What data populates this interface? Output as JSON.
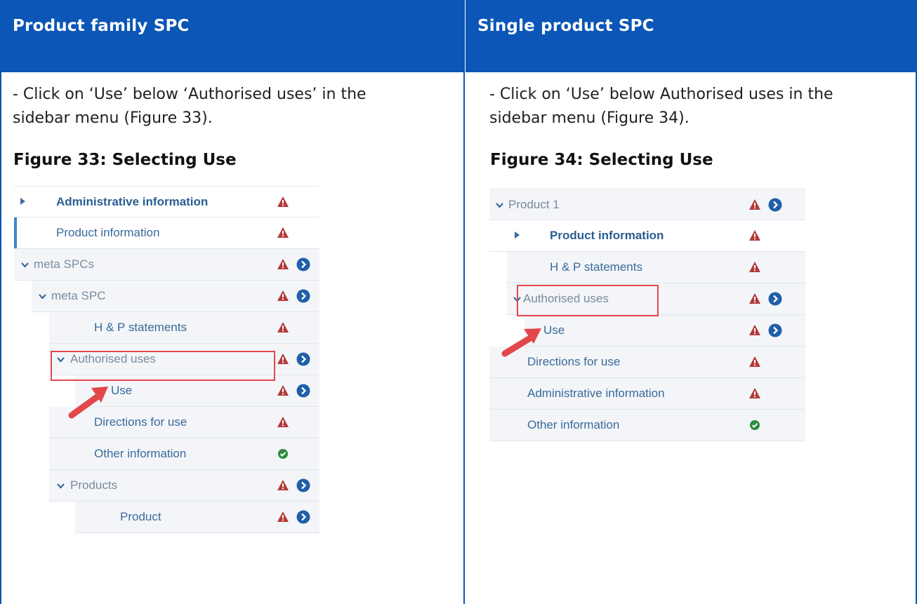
{
  "headers": {
    "left": "Product family SPC",
    "right": "Single product SPC"
  },
  "left": {
    "instruction_line1": "- Click on ‘Use’ below ‘Authorised uses’ in the",
    "instruction_line2": "sidebar menu (Figure 33).",
    "figure_title": "Figure 33: Selecting Use",
    "menu": [
      {
        "label": "Administrative information",
        "expander": "caret",
        "status": [
          "warning-icon"
        ]
      },
      {
        "label": "Product information",
        "status": [
          "warning-icon"
        ]
      },
      {
        "label": "meta SPCs",
        "expander": "chevron",
        "status": [
          "warning-icon",
          "go-icon"
        ]
      },
      {
        "label": "meta SPC",
        "expander": "chevron",
        "status": [
          "warning-icon",
          "go-icon"
        ]
      },
      {
        "label": "H & P statements",
        "status": [
          "warning-icon"
        ]
      },
      {
        "label": "Authorised uses",
        "expander": "chevron",
        "status": [
          "warning-icon",
          "go-icon"
        ]
      },
      {
        "label": "Use",
        "status": [
          "warning-icon",
          "go-icon"
        ]
      },
      {
        "label": "Directions for use",
        "status": [
          "warning-icon"
        ]
      },
      {
        "label": "Other information",
        "status": [
          "check-icon"
        ]
      },
      {
        "label": "Products",
        "expander": "chevron",
        "status": [
          "warning-icon",
          "go-icon"
        ]
      },
      {
        "label": "Product",
        "status": [
          "warning-icon",
          "go-icon"
        ]
      }
    ]
  },
  "right": {
    "instruction_line1": "- Click on ‘Use’ below Authorised uses in the",
    "instruction_line2": "sidebar menu (Figure 34).",
    "figure_title": "Figure 34: Selecting Use",
    "menu": [
      {
        "label": "Product 1",
        "expander": "chevron",
        "status": [
          "warning-icon",
          "go-icon"
        ]
      },
      {
        "label": "Product information",
        "expander": "caret",
        "status": [
          "warning-icon"
        ]
      },
      {
        "label": "H & P statements",
        "status": [
          "warning-icon"
        ]
      },
      {
        "label": "Authorised uses",
        "expander": "chevron",
        "status": [
          "warning-icon",
          "go-icon"
        ]
      },
      {
        "label": "Use",
        "status": [
          "warning-icon",
          "go-icon"
        ]
      },
      {
        "label": "Directions for use",
        "status": [
          "warning-icon"
        ]
      },
      {
        "label": "Administrative information",
        "status": [
          "warning-icon"
        ]
      },
      {
        "label": "Other information",
        "status": [
          "check-icon"
        ]
      }
    ]
  },
  "colors": {
    "header_bg": "#0b56b7",
    "warning": "#b33a3a",
    "go": "#1f5fa8",
    "check": "#2e8b3e",
    "highlight": "#e2474b",
    "arrow": "#e2474b"
  }
}
